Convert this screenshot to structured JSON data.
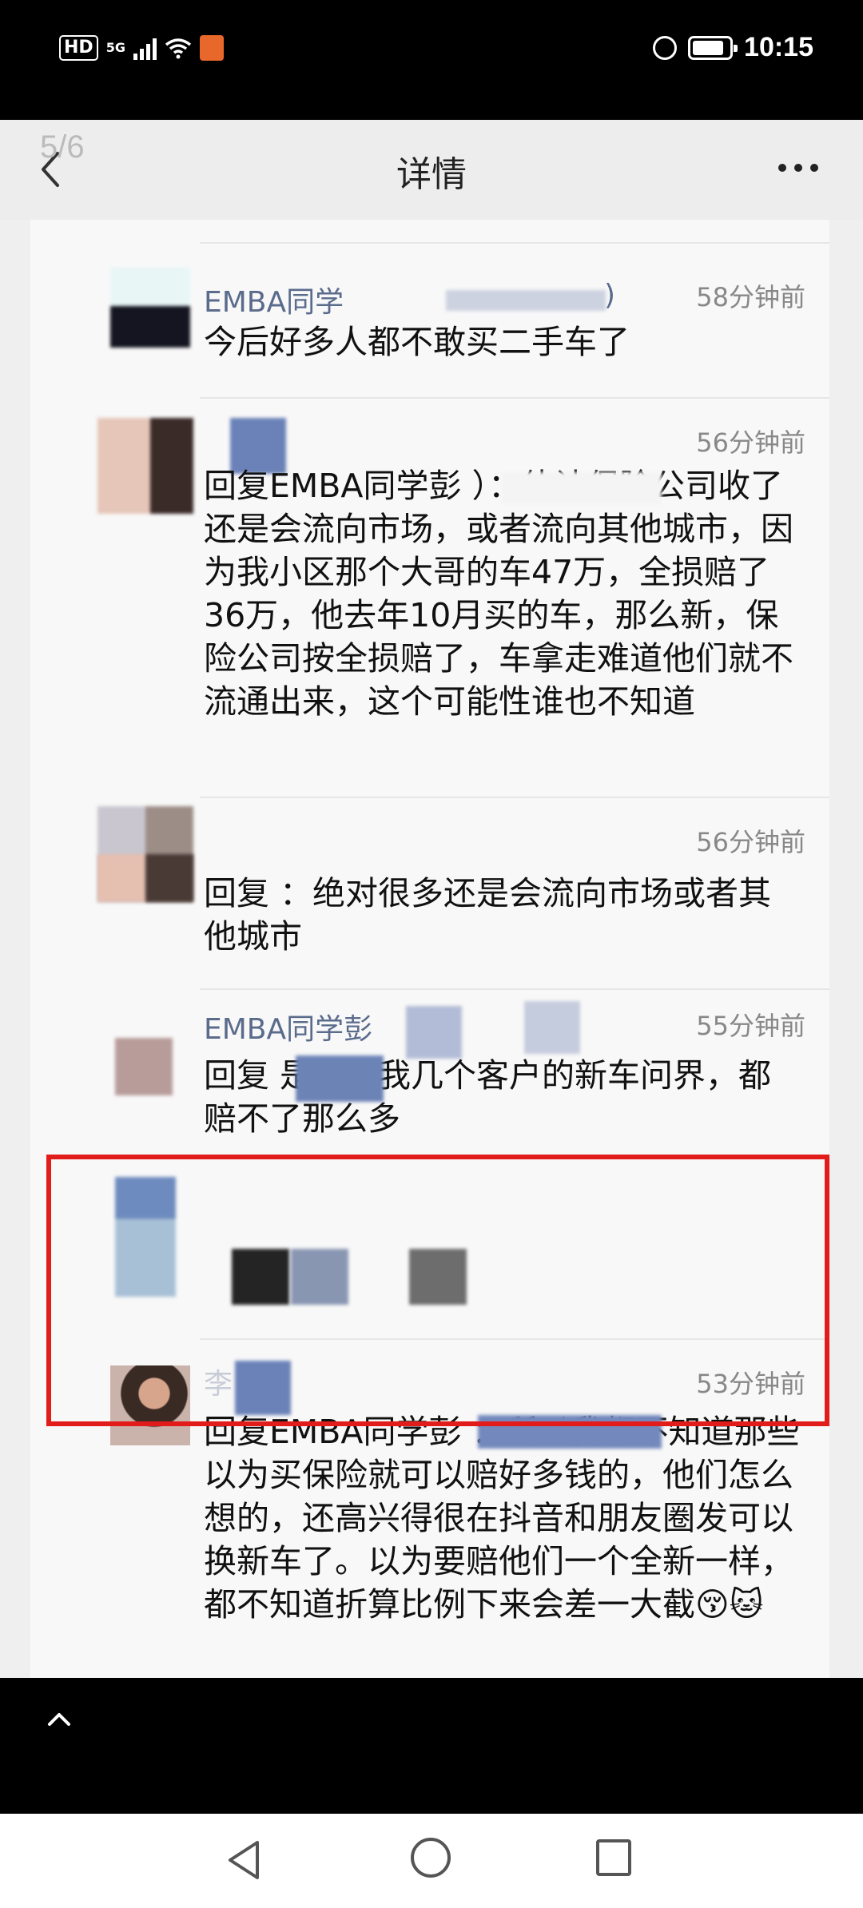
{
  "status_bar": {
    "hd": "HD",
    "signal": "5G",
    "time": "10:15"
  },
  "header": {
    "counter": "5/6",
    "title": "详情"
  },
  "comments": [
    {
      "name": "EMBA同学",
      "name_suffix": ")",
      "time": "58分钟前",
      "text": "今后好多人都不敢买二手车了"
    },
    {
      "name": "",
      "time": "56分钟前",
      "text": "回复EMBA同学彭          ）：估计保险公司收了还是会流向市场，或者流向其他城市，因为我小区那个大哥的车47万，全损赔了36万，他去年10月买的车，那么新，保险公司按全损赔了，车拿走难道他们就不流通出来，这个可能性谁也不知道"
    },
    {
      "name": "",
      "time": "56分钟前",
      "text": "回复          ：绝对很多还是会流向市场或者其他城市"
    },
    {
      "name": "EMBA同学彭",
      "time": "55分钟前",
      "text": "回复            是的，我几个客户的新车问界，都赔不了那么多"
    },
    {
      "name": "李",
      "time": "53分钟前",
      "text": "回复EMBA同学彭              ：所以我都不知道那些以为买保险就可以赔好多钱的，他们怎么想的，还高兴得很在抖音和朋友圈发可以换新车了。以为要赔他们一个全新一样，都不知道折算比例下来会差一大截😚🐱"
    }
  ],
  "colors": {
    "highlight": "#e21b1b",
    "name": "#5a6b8c",
    "time": "#888888"
  },
  "icons": {
    "back": "chevron-left-icon",
    "more": "more-dots-icon",
    "scroll_up": "chevron-up-icon"
  }
}
